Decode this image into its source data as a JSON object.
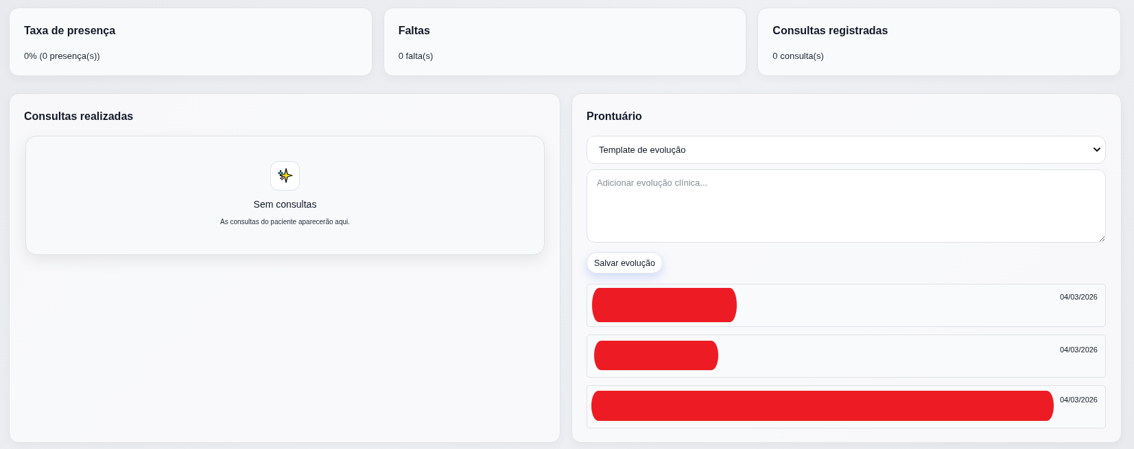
{
  "stat_cards": [
    {
      "title": "Taxa de presença",
      "value": "0% (0 presença(s))"
    },
    {
      "title": "Faltas",
      "value": "0 falta(s)"
    },
    {
      "title": "Consultas registradas",
      "value": "0 consulta(s)"
    }
  ],
  "consultations_panel": {
    "title": "Consultas realizadas",
    "empty_state": {
      "title": "Sem consultas",
      "message": "As consultas do paciente aparecerão aqui."
    }
  },
  "record_panel": {
    "title": "Prontuário",
    "template_select": {
      "value": "Template de evolução"
    },
    "note_field": {
      "placeholder": "Adicionar evolução clínica..."
    },
    "save_button": "Salvar evolução",
    "entries": [
      {
        "redacted": true,
        "date": "04/03/2026"
      },
      {
        "redacted": true,
        "date": "04/03/2026"
      },
      {
        "redacted": true,
        "date": "04/03/2026"
      }
    ]
  }
}
